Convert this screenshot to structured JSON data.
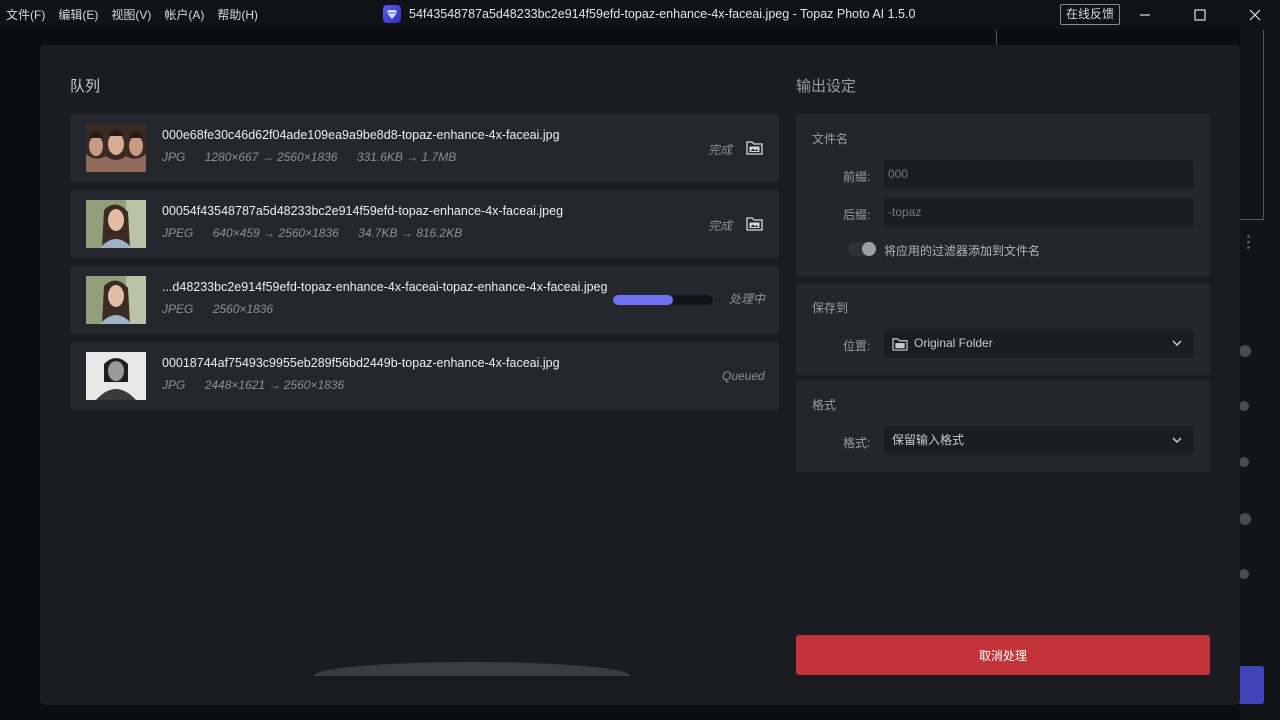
{
  "menu": [
    "文件(F)",
    "编辑(E)",
    "视图(V)",
    "帐户(A)",
    "帮助(H)"
  ],
  "window_title": "54f43548787a5d48233bc2e914f59efd-topaz-enhance-4x-faceai.jpeg - Topaz Photo AI 1.5.0",
  "feedback_label": "在线反馈",
  "queue": {
    "title": "队列",
    "items": [
      {
        "name": "000e68fe30c46d62f04ade109ea9a9be8d8-topaz-enhance-4x-faceai.jpg",
        "format": "JPG",
        "dims": "1280×667 → 2560×1836",
        "size": "331.6KB → 1.7MB",
        "status": "完成"
      },
      {
        "name": "00054f43548787a5d48233bc2e914f59efd-topaz-enhance-4x-faceai.jpeg",
        "format": "JPEG",
        "dims": "640×459 → 2560×1836",
        "size": "34.7KB → 816.2KB",
        "status": "完成"
      },
      {
        "name": "...d48233bc2e914f59efd-topaz-enhance-4x-faceai-topaz-enhance-4x-faceai.jpeg",
        "format": "JPEG",
        "dims": "2560×1836",
        "size": "",
        "status": "处理中",
        "progress": 0.6
      },
      {
        "name": "00018744af75493c9955eb289f56bd2449b-topaz-enhance-4x-faceai.jpg",
        "format": "JPG",
        "dims": "2448×1621 → 2560×1836",
        "size": "",
        "status": "Queued"
      }
    ]
  },
  "output": {
    "title": "输出设定",
    "filename": {
      "label": "文件名",
      "prefix_label": "前缀:",
      "prefix_value": "000",
      "suffix_label": "后缀:",
      "suffix_value": "-topaz",
      "toggle_label": "将应用的过滤器添加到文件名",
      "toggle_on": false
    },
    "save": {
      "label": "保存到",
      "location_label": "位置:",
      "location_value": "Original Folder"
    },
    "format": {
      "label": "格式",
      "format_label": "格式:",
      "format_value": "保留输入格式"
    }
  },
  "cancel_label": "取消处理",
  "colors": {
    "accent": "#6f72f0",
    "danger": "#c2333a",
    "panel": "#1a1c22"
  }
}
